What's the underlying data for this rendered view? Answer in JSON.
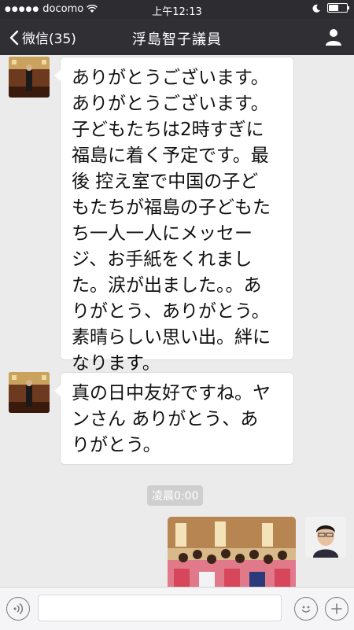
{
  "status_bar": {
    "carrier": "docomo",
    "time": "上午12:13"
  },
  "nav": {
    "back_label": "微信(35)",
    "title": "浮島智子議員"
  },
  "messages": [
    {
      "lines": [
        "ありがとうございます。",
        "ありがとうございます。",
        "子どもたちは2時すぎに",
        "福島に着く予定です。最",
        "後 控え室で中国の子ど",
        "もたちが福島の子どもた",
        "ち一人一人にメッセー",
        "ジ、お手紙をくれまし",
        "た。涙が出ました。。あ",
        "りがとう、ありがとう。",
        "素晴らしい思い出。絆に",
        "なります。"
      ]
    },
    {
      "lines": [
        "真の日中友好ですね。ヤ",
        "ンさん ありがとう、あ",
        "りがとう。"
      ]
    }
  ],
  "timestamp": "凌晨0:00",
  "colors": {
    "nav_bg": "#2f2f34",
    "chat_bg": "#ebebeb",
    "bubble_bg": "#ffffff"
  }
}
